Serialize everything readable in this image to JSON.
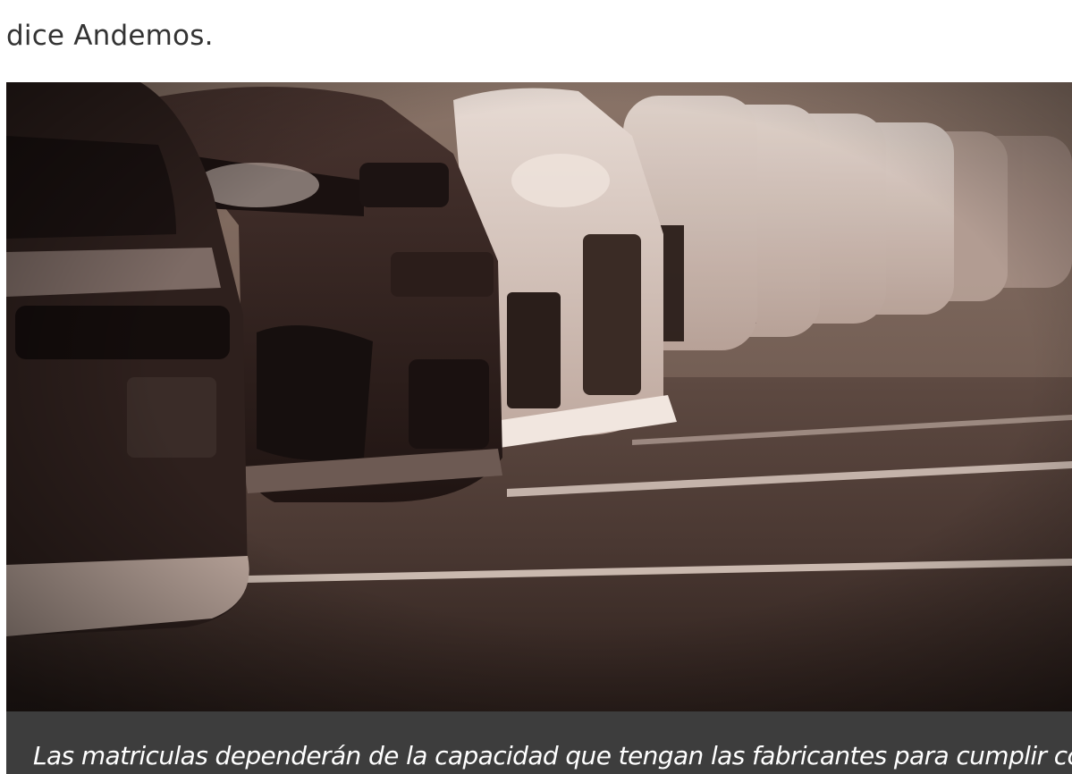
{
  "article": {
    "paragraph_tail": "dice Andemos.",
    "image_alt": "Fila de coches en un estacionamiento",
    "caption": "Las matriculas dependerán de la capacidad que tengan las fabricantes para cumplir con las"
  },
  "colors": {
    "text": "#333333",
    "caption_bg": "#3d3d3d",
    "caption_text": "#ffffff",
    "photo_tone": "#3a2a24"
  }
}
